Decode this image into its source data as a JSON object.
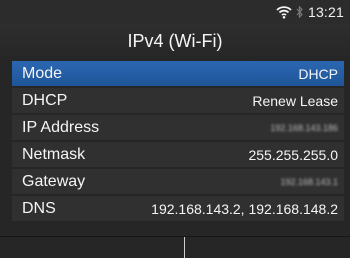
{
  "status": {
    "wifi_icon": "wifi-icon",
    "bluetooth_icon": "bluetooth-icon",
    "time": "13:21"
  },
  "title": "IPv4 (Wi-Fi)",
  "rows": [
    {
      "label": "Mode",
      "value": "DHCP",
      "selected": true
    },
    {
      "label": "DHCP",
      "value": "Renew Lease",
      "selected": false
    },
    {
      "label": "IP Address",
      "value": "192.168.143.186",
      "selected": false
    },
    {
      "label": "Netmask",
      "value": "255.255.255.0",
      "selected": false
    },
    {
      "label": "Gateway",
      "value": "192.168.143.1",
      "selected": false
    },
    {
      "label": "DNS",
      "value": "192.168.143.2, 192.168.148.2",
      "selected": false
    }
  ],
  "colors": {
    "selected_row": "#2360a8",
    "row_background": "#303030",
    "screen_background": "#262626"
  }
}
